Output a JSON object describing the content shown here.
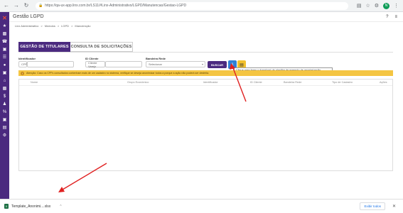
{
  "browser": {
    "url": "https://qa-ux-app.linx.com.br/LS11/#Linx-Administrativo/LGPD/Manutencao/Gestao-LGPD",
    "profile_initial": "N"
  },
  "header": {
    "title": "Gestão LGPD"
  },
  "breadcrumb": [
    "Linx Administrativo",
    ">",
    "Módulos",
    ">",
    "LGPD",
    ">",
    "Manutenção"
  ],
  "tabs": [
    {
      "label": "GESTÃO DE TITULARES"
    },
    {
      "label": "CONSULTA DE SOLICITAÇÕES"
    }
  ],
  "filters": {
    "identificador_label": "Identificador",
    "identificador_type": "CPF",
    "id_cliente_label": "ID Cliente",
    "id_cliente_type": "Cliente Varejo",
    "bandeira_label": "Bandeira Rede",
    "bandeira_value": "Selecionar",
    "buscar_label": "BUSCAR"
  },
  "tooltip": "Clique para fazer o download da planilha de exemplo de anonimização.",
  "alert": "Atenção: Caso os CPFs consultados contenham mais de um cadastro no sistema, verifique se deseja anonimizar todos a porque a ação não poderá ser desfeita.",
  "table": {
    "columns": [
      "Nome",
      "Grupo Econômico",
      "Identificador",
      "ID Cliente",
      "Bandeira Rede",
      "Tipo de Cadastro",
      "Ações"
    ]
  },
  "download": {
    "filename": "Template_Anonimi....xlsx",
    "show_all": "Exibir todos"
  },
  "colors": {
    "primary": "#4b2a7f",
    "alert": "#f4c542",
    "arrow": "#e02020"
  }
}
